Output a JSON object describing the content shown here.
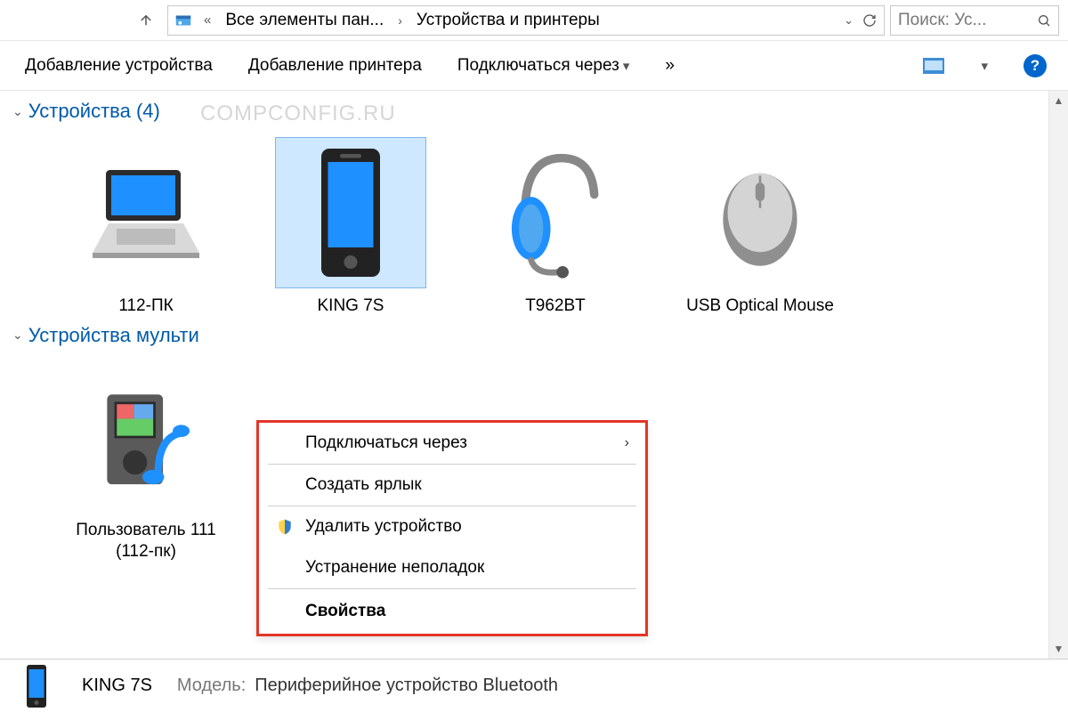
{
  "address": {
    "crumb1": "Все элементы пан...",
    "crumb2": "Устройства и принтеры",
    "search_placeholder": "Поиск: Ус..."
  },
  "toolbar": {
    "add_device": "Добавление устройства",
    "add_printer": "Добавление принтера",
    "connect_via": "Подключаться через",
    "overflow": "»"
  },
  "groups": {
    "devices_title": "Устройства (4)",
    "multimedia_title": "Устройства мульти"
  },
  "watermark": "COMPCONFIG.RU",
  "devices": [
    {
      "label": "112-ПК"
    },
    {
      "label": "KING 7S"
    },
    {
      "label": "T962BT"
    },
    {
      "label": "USB Optical Mouse"
    }
  ],
  "multimedia": [
    {
      "label": "Пользователь 111 (112-пк)"
    }
  ],
  "context_menu": {
    "connect_via": "Подключаться через",
    "create_shortcut": "Создать ярлык",
    "remove_device": "Удалить устройство",
    "troubleshoot": "Устранение неполадок",
    "properties": "Свойства"
  },
  "details": {
    "name": "KING 7S",
    "model_label": "Модель:",
    "model_value": "Периферийное устройство Bluetooth"
  }
}
